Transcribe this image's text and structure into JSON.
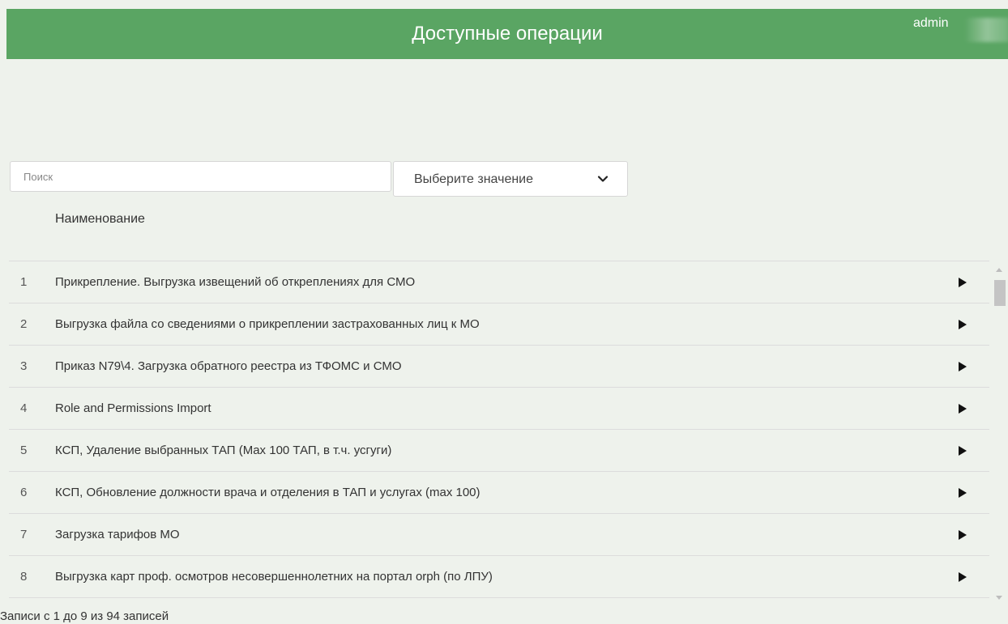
{
  "header": {
    "title": "Доступные операции",
    "user": "admin",
    "background_color": "#5aa563"
  },
  "filters": {
    "search_placeholder": "Поиск",
    "select_value": "Выберите значение",
    "select_icon": "chevron-down-icon"
  },
  "table": {
    "column_header": "Наименование",
    "rows": [
      {
        "num": "1",
        "name": "Прикрепление. Выгрузка извещений об откреплениях для СМО"
      },
      {
        "num": "2",
        "name": "Выгрузка файла со сведениями о прикреплении застрахованных лиц к МО"
      },
      {
        "num": "3",
        "name": "Приказ N79\\4. Загрузка обратного реестра из ТФОМС и СМО"
      },
      {
        "num": "4",
        "name": "Role and Permissions Import"
      },
      {
        "num": "5",
        "name": "КСП, Удаление выбранных ТАП (Max 100 ТАП, в т.ч. усгуги)"
      },
      {
        "num": "6",
        "name": "КСП, Обновление должности врача и отделения в ТАП и услугах (max 100)"
      },
      {
        "num": "7",
        "name": "Загрузка тарифов МО"
      },
      {
        "num": "8",
        "name": "Выгрузка карт проф. осмотров несовершеннолетних на портал orph (по ЛПУ)"
      }
    ],
    "row_icon": "triangle-right-icon"
  },
  "footer": {
    "records_info": "Записи с 1 до 9 из 94 записей"
  }
}
